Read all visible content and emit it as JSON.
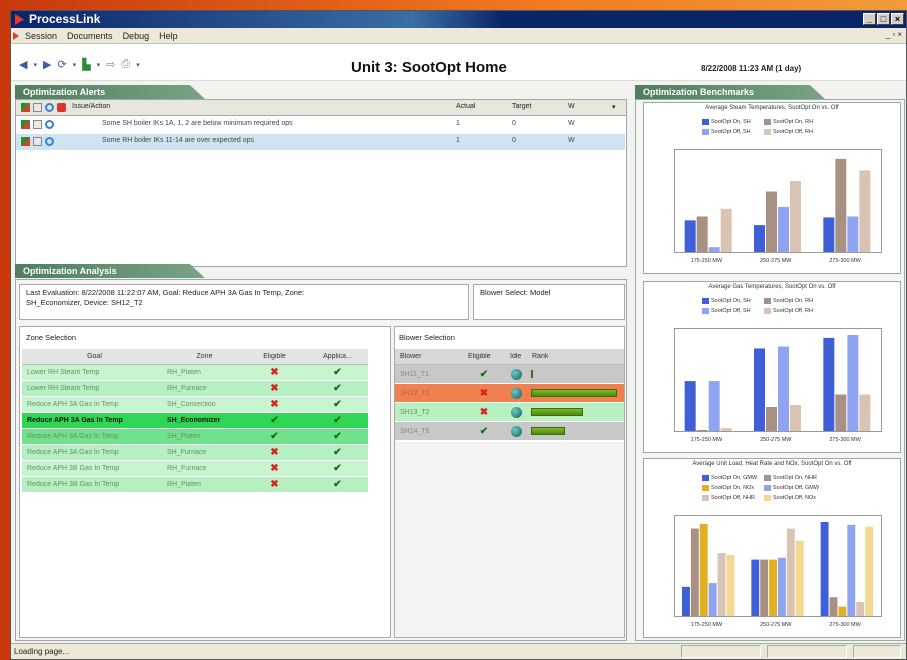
{
  "window": {
    "title": "ProcessLink",
    "min": "_",
    "max": "□",
    "close": "×"
  },
  "menu": [
    "Session",
    "Documents",
    "Debug",
    "Help"
  ],
  "mdi_buttons": {
    "min": "_",
    "restore": "▫",
    "close": "×"
  },
  "toolbar": {
    "page_title": "Unit 3: SootOpt Home",
    "datetime": "8/22/2008 11:23 AM (1 day)"
  },
  "alerts": {
    "header": "Optimization Alerts",
    "columns": [
      "Issue/Action",
      "Actual",
      "Target",
      "W"
    ],
    "rows": [
      {
        "issue": "Some SH boiler IKs 1A, 1, 2 are below minimum required ops",
        "actual": "1",
        "target": "0",
        "w": "W"
      },
      {
        "issue": "Some RH boiler IKs 11-14 are over expected ops",
        "actual": "1",
        "target": "0",
        "w": "W"
      }
    ]
  },
  "analysis": {
    "header": "Optimization Analysis",
    "evaluation_line1": "Last Evaluation: 8/22/2008 11:22:07 AM,  Goal: Reduce APH 3A Gas In Temp,  Zone:",
    "evaluation_line2": "SH_Economizer,  Device: SH12_T2",
    "blower_select": "Blower Select: Model",
    "zone_title": "Zone Selection",
    "zone_columns": [
      "Goal",
      "Zone",
      "Eligible",
      "Applica..."
    ],
    "zones": [
      {
        "goal": "Lower RH Steam Temp",
        "zone": "RH_Platen",
        "eligible": "✖",
        "applicable": "✔",
        "style": "row"
      },
      {
        "goal": "Lower RH Steam Temp",
        "zone": "RH_Furnace",
        "eligible": "✖",
        "applicable": "✔",
        "style": "alt"
      },
      {
        "goal": "Reduce APH 3A Gas In Temp",
        "zone": "SH_Convection",
        "eligible": "✖",
        "applicable": "✔",
        "style": "row"
      },
      {
        "goal": "Reduce APH 3A Gas In Temp",
        "zone": "SH_Economizer",
        "eligible": "✔",
        "applicable": "✔",
        "style": "sel"
      },
      {
        "goal": "Reduce APH 3A Gas In Temp",
        "zone": "SH_Platen",
        "eligible": "✔",
        "applicable": "✔",
        "style": "sel2"
      },
      {
        "goal": "Reduce APH 3A Gas In Temp",
        "zone": "SH_Furnace",
        "eligible": "✖",
        "applicable": "✔",
        "style": "alt"
      },
      {
        "goal": "Reduce APH 3B Gas In Temp",
        "zone": "RH_Furnace",
        "eligible": "✖",
        "applicable": "✔",
        "style": "row"
      },
      {
        "goal": "Reduce APH 3B Gas In Temp",
        "zone": "RH_Platen",
        "eligible": "✖",
        "applicable": "✔",
        "style": "alt"
      }
    ],
    "blower_title": "Blower Selection",
    "blower_columns": [
      "Blower",
      "Eligible",
      "Idle",
      "Rank"
    ],
    "blowers": [
      {
        "name": "SH11_T1",
        "eligible": "✔",
        "rank": 0.0,
        "bg": "#c8c8c8",
        "color": "#888"
      },
      {
        "name": "SH12_T2",
        "eligible": "✖",
        "rank": 1.0,
        "bg": "#f08050",
        "color": "#a64"
      },
      {
        "name": "SH13_T2",
        "eligible": "✖",
        "rank": 0.6,
        "bg": "#b8f0c2",
        "color": "#6a8f6a"
      },
      {
        "name": "SH14_T6",
        "eligible": "✔",
        "rank": 0.4,
        "bg": "#c8c8c8",
        "color": "#888"
      }
    ]
  },
  "benchmarks": {
    "header": "Optimization Benchmarks",
    "charts": [
      {
        "title": "Average Steam Temperatures, SootOpt On vs. Off",
        "legend": [
          {
            "name": "SootOpt On, SH",
            "color": "#3f5fd6"
          },
          {
            "name": "SootOpt On, RH",
            "color": "#a89082"
          },
          {
            "name": "SootOpt Off, SH",
            "color": "#8fa4f0"
          },
          {
            "name": "SootOpt Off, RH",
            "color": "#d9c4b4"
          }
        ]
      },
      {
        "title": "Average Gas Temperatures, SootOpt On vs. Off",
        "legend": [
          {
            "name": "SootOpt On, SH",
            "color": "#3f5fd6"
          },
          {
            "name": "SootOpt On, RH",
            "color": "#a89082"
          },
          {
            "name": "SootOpt Off, SH",
            "color": "#8fa4f0"
          },
          {
            "name": "SootOpt Off, RH",
            "color": "#d9c4b4"
          }
        ]
      },
      {
        "title": "Average Unit Load, Heat Rate and NOx, SootOpt On vs. Off",
        "legend": [
          {
            "name": "SootOpt On, GMW",
            "color": "#3f5fd6"
          },
          {
            "name": "SootOpt On, NHR",
            "color": "#a89082"
          },
          {
            "name": "SootOpt On, NOx",
            "color": "#e0b020"
          },
          {
            "name": "SootOpt Off, GMW",
            "color": "#8fa4f0"
          },
          {
            "name": "SootOpt Off, NHR",
            "color": "#d9c4b4"
          },
          {
            "name": "SootOpt Off, NOx",
            "color": "#f5d890"
          }
        ]
      }
    ]
  },
  "chart_data": [
    {
      "type": "bar",
      "title": "Average Steam Temperatures, SootOpt On vs. Off",
      "categories": [
        "175-250 MW",
        "250-275 MW",
        "275-300 MW"
      ],
      "series": [
        {
          "name": "SootOpt On, SH",
          "values": [
            0.33,
            0.28,
            0.36
          ]
        },
        {
          "name": "SootOpt On, RH",
          "values": [
            0.37,
            0.63,
            0.97
          ]
        },
        {
          "name": "SootOpt Off, SH",
          "values": [
            0.05,
            0.47,
            0.37
          ]
        },
        {
          "name": "SootOpt Off, RH",
          "values": [
            0.45,
            0.74,
            0.85
          ]
        }
      ]
    },
    {
      "type": "bar",
      "title": "Average Gas Temperatures, SootOpt On vs. Off",
      "categories": [
        "175-250 MW",
        "250-275 MW",
        "275-300 MW"
      ],
      "series": [
        {
          "name": "SootOpt On, SH",
          "values": [
            0.52,
            0.86,
            0.97
          ]
        },
        {
          "name": "SootOpt On, RH",
          "values": [
            0.0,
            0.25,
            0.38
          ]
        },
        {
          "name": "SootOpt Off, SH",
          "values": [
            0.52,
            0.88,
            1.0
          ]
        },
        {
          "name": "SootOpt Off, RH",
          "values": [
            0.03,
            0.27,
            0.38
          ]
        }
      ]
    },
    {
      "type": "bar",
      "title": "Average Unit Load, Heat Rate and NOx, SootOpt On vs. Off",
      "categories": [
        "175-250 MW",
        "250-275 MW",
        "275-300 MW"
      ],
      "series": [
        {
          "name": "SootOpt On, GMW",
          "values": [
            0.31,
            0.6,
            1.0
          ]
        },
        {
          "name": "SootOpt On, NHR",
          "values": [
            0.93,
            0.6,
            0.2
          ]
        },
        {
          "name": "SootOpt On, NOx",
          "values": [
            0.98,
            0.6,
            0.1
          ]
        },
        {
          "name": "SootOpt Off, GMW",
          "values": [
            0.35,
            0.62,
            0.97
          ]
        },
        {
          "name": "SootOpt Off, NHR",
          "values": [
            0.67,
            0.93,
            0.15
          ]
        },
        {
          "name": "SootOpt Off, NOx",
          "values": [
            0.65,
            0.8,
            0.95
          ]
        }
      ]
    }
  ],
  "status": {
    "text": "Loading page..."
  }
}
